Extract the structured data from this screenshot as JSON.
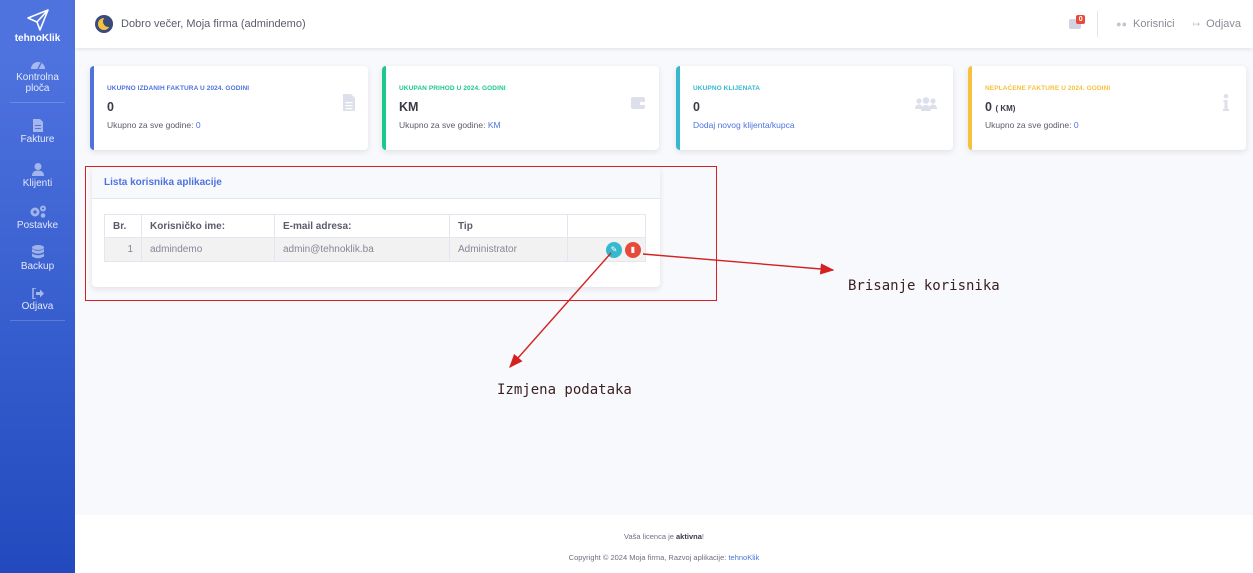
{
  "brand": {
    "name": "tehnoKlik"
  },
  "sidebar": {
    "items": [
      {
        "label": "Kontrolna ploča",
        "icon": "tachometer-icon"
      },
      {
        "label": "Fakture",
        "icon": "invoice-icon"
      },
      {
        "label": "Klijenti",
        "icon": "user-icon"
      },
      {
        "label": "Postavke",
        "icon": "gears-icon"
      },
      {
        "label": "Backup",
        "icon": "database-icon"
      },
      {
        "label": "Odjava",
        "icon": "sign-out-icon"
      }
    ]
  },
  "topbar": {
    "greeting": "Dobro večer, Moja firma (admindemo)",
    "notification_count": "0",
    "users_link": "Korisnici",
    "logout_link": "Odjava"
  },
  "cards": [
    {
      "title": "UKUPNO IZDANIH FAKTURA U 2024. GODINI",
      "value": "0",
      "sub_text": "Ukupno za sve godine:",
      "sub_value": "0",
      "color": "#4e73df",
      "icon": "invoice-icon"
    },
    {
      "title": "UKUPAN PRIHOD U 2024. GODINI",
      "value": "KM",
      "sub_text": "Ukupno za sve godine:",
      "sub_value": "KM",
      "color": "#1cc88a",
      "icon": "wallet-icon"
    },
    {
      "title": "UKUPNO KLIJENATA",
      "value": "0",
      "sub_link": "Dodaj novog klijenta/kupca",
      "color": "#36b9cc",
      "icon": "users-icon"
    },
    {
      "title": "NEPLAĆENE FAKTURE U 2024. GODINI",
      "value": "0",
      "value_suffix": "( KM)",
      "sub_text": "Ukupno za sve godine:",
      "sub_value": "0",
      "color": "#f6c23e",
      "icon": "info-icon"
    }
  ],
  "users_panel": {
    "title": "Lista korisnika aplikacije",
    "columns": [
      "Br.",
      "Korisničko ime:",
      "E-mail adresa:",
      "Tip",
      ""
    ],
    "rows": [
      {
        "num": "1",
        "username": "admindemo",
        "email": "admin@tehnoklik.ba",
        "type": "Administrator"
      }
    ]
  },
  "annotations": {
    "delete": "Brisanje korisnika",
    "edit": "Izmjena podataka",
    "color": "#d42020"
  },
  "footer": {
    "license_prefix": "Vaša licenca je",
    "license_status": "aktivna",
    "license_suffix": "!",
    "copyright": "Copyright © 2024 Moja firma, Razvoj aplikacije:",
    "dev_link": "tehnoKlik"
  }
}
